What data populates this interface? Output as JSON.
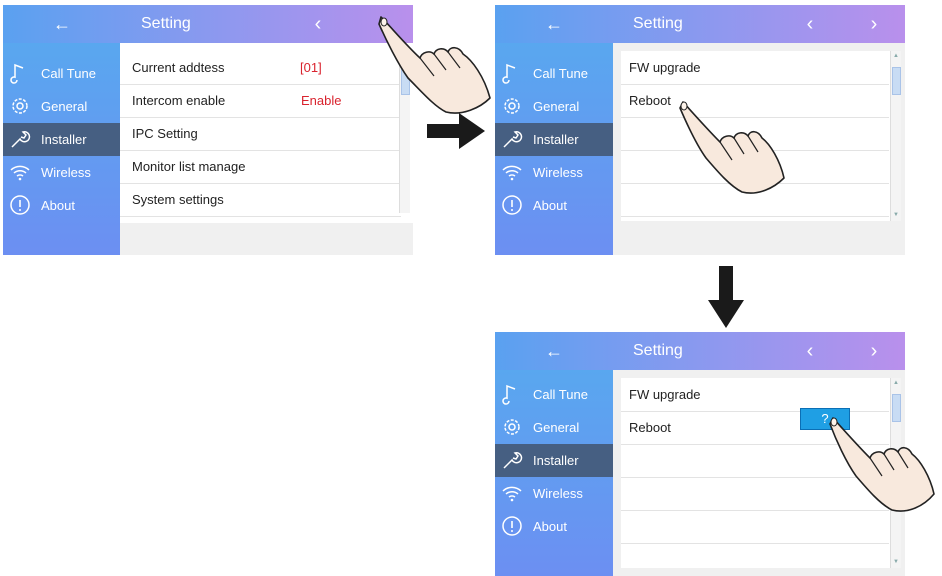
{
  "header": {
    "back_icon": "←",
    "title": "Setting",
    "prev_icon": "‹",
    "next_icon": "›"
  },
  "sidebar": {
    "items": [
      {
        "label": "Call Tune",
        "icon": "music-note-icon"
      },
      {
        "label": "General",
        "icon": "gear-icon"
      },
      {
        "label": "Installer",
        "icon": "wrench-icon"
      },
      {
        "label": "Wireless",
        "icon": "wifi-icon"
      },
      {
        "label": "About",
        "icon": "info-icon"
      }
    ],
    "selected": "Installer"
  },
  "screen1": {
    "rows": [
      {
        "label": "Current addtess",
        "value": "[01]"
      },
      {
        "label": "Intercom enable",
        "value": "Enable"
      },
      {
        "label": "IPC Setting"
      },
      {
        "label": "Monitor list manage"
      },
      {
        "label": "System settings"
      }
    ]
  },
  "screen2": {
    "rows": [
      {
        "label": "FW upgrade"
      },
      {
        "label": "Reboot"
      }
    ]
  },
  "screen3": {
    "rows": [
      {
        "label": "FW upgrade"
      },
      {
        "label": "Reboot"
      }
    ],
    "confirm_label": "?"
  },
  "colors": {
    "header_start": "#5aa1f0",
    "header_end": "#b990ec",
    "sidebar": "#6c8ff2",
    "selected": "#465f82",
    "value_red": "#d9232e",
    "confirm_blue": "#1f9fe4"
  }
}
